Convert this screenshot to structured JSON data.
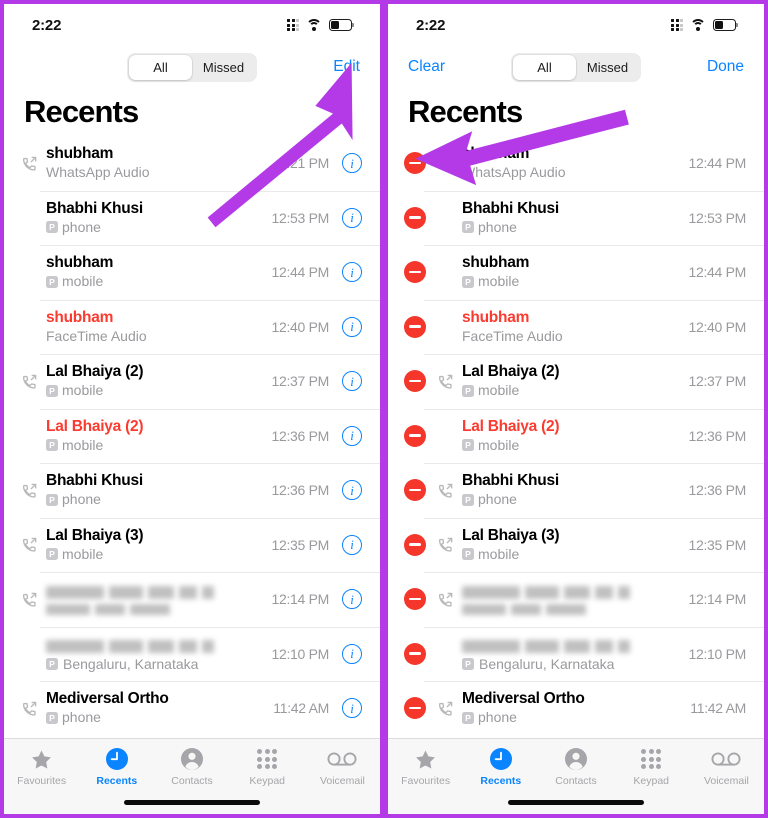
{
  "accent": {
    "arrow_purple": "#b43ae8",
    "ios_blue": "#0a84ff",
    "missed_red": "#fc3b30",
    "delete_red": "#f4372a",
    "subtext_gray": "#9a9a9e"
  },
  "status_bar": {
    "time": "2:22",
    "signal_icon": "signal-grid-icon",
    "wifi_icon": "wifi-icon",
    "battery_icon": "battery-icon",
    "battery_level_pct": 42
  },
  "segmented_control": {
    "options": [
      "All",
      "Missed"
    ],
    "selected": "All"
  },
  "page_title": "Recents",
  "left_panel": {
    "nav_left_label": "",
    "nav_right_label": "Edit",
    "edit_mode": false,
    "rows": [
      {
        "name": "shubham",
        "subtitle": "WhatsApp Audio",
        "badge": "",
        "time": "2:21 PM",
        "missed": false,
        "call_icon": true,
        "blurred": false
      },
      {
        "name": "Bhabhi Khusi",
        "subtitle": "phone",
        "badge": "P",
        "time": "12:53 PM",
        "missed": false,
        "call_icon": false,
        "blurred": false
      },
      {
        "name": "shubham",
        "subtitle": "mobile",
        "badge": "P",
        "time": "12:44 PM",
        "missed": false,
        "call_icon": false,
        "blurred": false
      },
      {
        "name": "shubham",
        "subtitle": "FaceTime Audio",
        "badge": "",
        "time": "12:40 PM",
        "missed": true,
        "call_icon": false,
        "blurred": false
      },
      {
        "name": "Lal Bhaiya (2)",
        "subtitle": "mobile",
        "badge": "P",
        "time": "12:37 PM",
        "missed": false,
        "call_icon": true,
        "blurred": false
      },
      {
        "name": "Lal Bhaiya (2)",
        "subtitle": "mobile",
        "badge": "P",
        "time": "12:36 PM",
        "missed": true,
        "call_icon": false,
        "blurred": false
      },
      {
        "name": "Bhabhi Khusi",
        "subtitle": "phone",
        "badge": "P",
        "time": "12:36 PM",
        "missed": false,
        "call_icon": true,
        "blurred": false
      },
      {
        "name": "Lal Bhaiya (3)",
        "subtitle": "mobile",
        "badge": "P",
        "time": "12:35 PM",
        "missed": false,
        "call_icon": true,
        "blurred": false
      },
      {
        "name": "",
        "subtitle": "",
        "badge": "",
        "time": "12:14 PM",
        "missed": false,
        "call_icon": true,
        "blurred": true
      },
      {
        "name": "",
        "subtitle": "Bengaluru, Karnataka",
        "badge": "P",
        "time": "12:10 PM",
        "missed": false,
        "call_icon": false,
        "blurred": true
      },
      {
        "name": "Mediversal Ortho",
        "subtitle": "phone",
        "badge": "P",
        "time": "11:42 AM",
        "missed": false,
        "call_icon": true,
        "blurred": false
      }
    ]
  },
  "right_panel": {
    "nav_left_label": "Clear",
    "nav_right_label": "Done",
    "edit_mode": true,
    "rows": [
      {
        "name": "shubham",
        "subtitle": "WhatsApp Audio",
        "badge": "",
        "time": "12:44 PM",
        "missed": false,
        "call_icon": false,
        "blurred": false
      },
      {
        "name": "Bhabhi Khusi",
        "subtitle": "phone",
        "badge": "P",
        "time": "12:53 PM",
        "missed": false,
        "call_icon": false,
        "blurred": false
      },
      {
        "name": "shubham",
        "subtitle": "mobile",
        "badge": "P",
        "time": "12:44 PM",
        "missed": false,
        "call_icon": false,
        "blurred": false
      },
      {
        "name": "shubham",
        "subtitle": "FaceTime Audio",
        "badge": "",
        "time": "12:40 PM",
        "missed": true,
        "call_icon": false,
        "blurred": false
      },
      {
        "name": "Lal Bhaiya (2)",
        "subtitle": "mobile",
        "badge": "P",
        "time": "12:37 PM",
        "missed": false,
        "call_icon": true,
        "blurred": false
      },
      {
        "name": "Lal Bhaiya (2)",
        "subtitle": "mobile",
        "badge": "P",
        "time": "12:36 PM",
        "missed": true,
        "call_icon": false,
        "blurred": false
      },
      {
        "name": "Bhabhi Khusi",
        "subtitle": "phone",
        "badge": "P",
        "time": "12:36 PM",
        "missed": false,
        "call_icon": true,
        "blurred": false
      },
      {
        "name": "Lal Bhaiya (3)",
        "subtitle": "mobile",
        "badge": "P",
        "time": "12:35 PM",
        "missed": false,
        "call_icon": true,
        "blurred": false
      },
      {
        "name": "",
        "subtitle": "",
        "badge": "",
        "time": "12:14 PM",
        "missed": false,
        "call_icon": true,
        "blurred": true
      },
      {
        "name": "",
        "subtitle": "Bengaluru, Karnataka",
        "badge": "P",
        "time": "12:10 PM",
        "missed": false,
        "call_icon": false,
        "blurred": true
      },
      {
        "name": "Mediversal Ortho",
        "subtitle": "phone",
        "badge": "P",
        "time": "11:42 AM",
        "missed": false,
        "call_icon": true,
        "blurred": false
      }
    ]
  },
  "tab_bar": {
    "items": [
      {
        "label": "Favourites",
        "icon": "star-icon",
        "active": false
      },
      {
        "label": "Recents",
        "icon": "clock-icon",
        "active": true
      },
      {
        "label": "Contacts",
        "icon": "person-circle-icon",
        "active": false
      },
      {
        "label": "Keypad",
        "icon": "keypad-dots-icon",
        "active": false
      },
      {
        "label": "Voicemail",
        "icon": "voicemail-icon",
        "active": false
      }
    ]
  },
  "annotations": [
    {
      "name": "arrow-pointing-to-edit-button",
      "panel": "left"
    },
    {
      "name": "arrow-pointing-to-delete-button",
      "panel": "right"
    }
  ]
}
